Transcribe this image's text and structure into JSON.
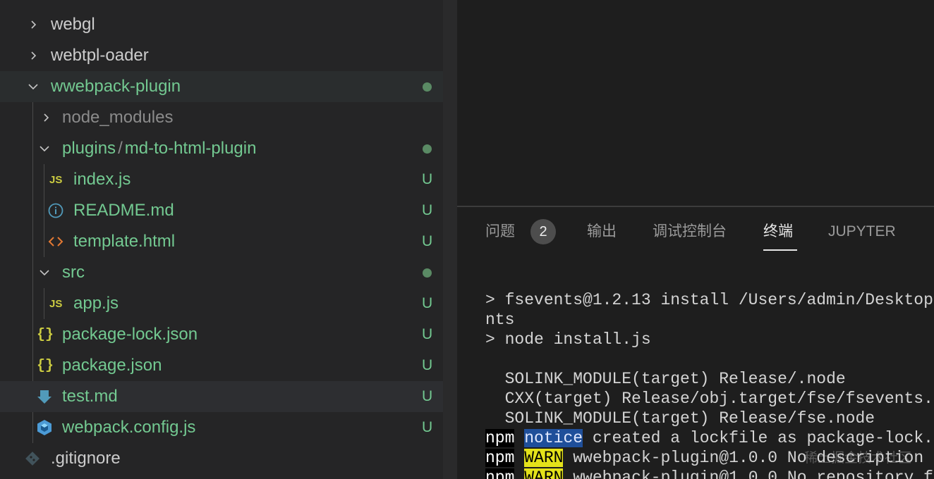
{
  "explorer": {
    "items": [
      {
        "label": "webgl",
        "type": "folder",
        "expanded": false,
        "color": "#cccccc",
        "status": ""
      },
      {
        "label": "webtpl-oader",
        "type": "folder",
        "expanded": false,
        "color": "#cccccc",
        "status": ""
      },
      {
        "label": "wwebpack-plugin",
        "type": "folder",
        "expanded": true,
        "color": "#73c991",
        "status": "dot"
      },
      {
        "label": "node_modules",
        "type": "folder",
        "expanded": false,
        "color": "#8b8b8b",
        "status": ""
      },
      {
        "label_prefix": "plugins",
        "label_sep": "/",
        "label": "md-to-html-plugin",
        "type": "folder",
        "expanded": true,
        "color": "#73c991",
        "status": "dot"
      },
      {
        "label": "index.js",
        "type": "file",
        "icon": "js-icon",
        "icon_text": "JS",
        "color": "#73c991",
        "status": "U"
      },
      {
        "label": "README.md",
        "type": "file",
        "icon": "info-icon",
        "color": "#73c991",
        "status": "U"
      },
      {
        "label": "template.html",
        "type": "file",
        "icon": "html-code-icon",
        "color": "#73c991",
        "status": "U"
      },
      {
        "label": "src",
        "type": "folder",
        "expanded": true,
        "color": "#73c991",
        "status": "dot"
      },
      {
        "label": "app.js",
        "type": "file",
        "icon": "js-icon",
        "icon_text": "JS",
        "color": "#73c991",
        "status": "U"
      },
      {
        "label": "package-lock.json",
        "type": "file",
        "icon": "json-braces-icon",
        "icon_text": "{}",
        "color": "#73c991",
        "status": "U"
      },
      {
        "label": "package.json",
        "type": "file",
        "icon": "json-braces-icon",
        "icon_text": "{}",
        "color": "#73c991",
        "status": "U"
      },
      {
        "label": "test.md",
        "type": "file",
        "icon": "markdown-arrow-icon",
        "color": "#73c991",
        "status": "U"
      },
      {
        "label": "webpack.config.js",
        "type": "file",
        "icon": "webpack-cube-icon",
        "color": "#73c991",
        "status": "U"
      },
      {
        "label": ".gitignore",
        "type": "file",
        "icon": "git-icon",
        "color": "#cccccc",
        "status": ""
      }
    ]
  },
  "panel": {
    "tabs": [
      {
        "label": "问题",
        "active": false
      },
      {
        "label": "输出",
        "active": false
      },
      {
        "label": "调试控制台",
        "active": false
      },
      {
        "label": "终端",
        "active": true
      },
      {
        "label": "JUPYTER",
        "active": false
      }
    ],
    "problems_count": "2"
  },
  "terminal": {
    "lines": [
      "> fsevents@1.2.13 install /Users/admin/Desktop",
      "nts",
      "> node install.js",
      "",
      "  SOLINK_MODULE(target) Release/.node",
      "  CXX(target) Release/obj.target/fse/fsevents.",
      "  SOLINK_MODULE(target) Release/fse.node"
    ],
    "npm_lines": [
      {
        "npm": "npm",
        "level": "notice",
        "text": " created a lockfile as package-lock."
      },
      {
        "npm": "npm",
        "level": "WARN",
        "text": " wwebpack-plugin@1.0.0 No description"
      },
      {
        "npm": "npm",
        "level": "WARN",
        "text": " wwebpack-plugin@1.0.0 No repository f"
      }
    ]
  },
  "watermark": "稀土掘金技术社区",
  "colors": {
    "untracked_green": "#73c991",
    "js_yellow": "#cbcb41",
    "info_blue": "#519aba",
    "html_orange": "#e37933",
    "markdown_blue": "#519aba",
    "warn_yellow": "#e4e21a",
    "notice_blue": "#1f4f9a"
  }
}
